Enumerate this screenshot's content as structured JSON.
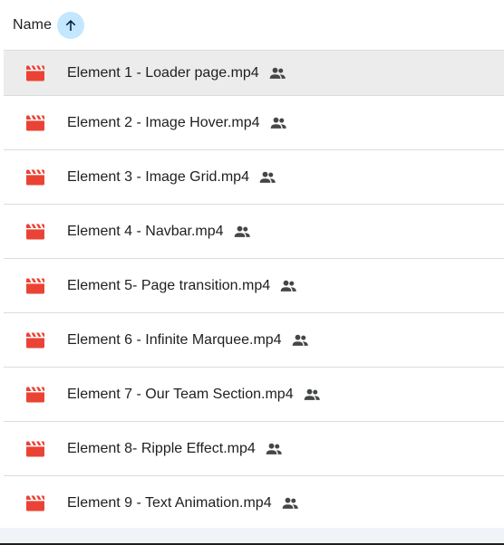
{
  "header": {
    "column_label": "Name",
    "sort_icon": "arrow-up-icon",
    "sort_color": "#c2e7ff"
  },
  "files": [
    {
      "name": "Element 1 - Loader page.mp4",
      "icon": "video-file-icon",
      "shared": true,
      "selected": true
    },
    {
      "name": "Element 2 - Image Hover.mp4",
      "icon": "video-file-icon",
      "shared": true
    },
    {
      "name": "Element 3 - Image Grid.mp4",
      "icon": "video-file-icon",
      "shared": true
    },
    {
      "name": "Element 4 - Navbar.mp4",
      "icon": "video-file-icon",
      "shared": true
    },
    {
      "name": "Element 5- Page transition.mp4",
      "icon": "video-file-icon",
      "shared": true
    },
    {
      "name": "Element 6 - Infinite Marquee.mp4",
      "icon": "video-file-icon",
      "shared": true
    },
    {
      "name": "Element 7 - Our Team Section.mp4",
      "icon": "video-file-icon",
      "shared": true
    },
    {
      "name": "Element 8- Ripple Effect.mp4",
      "icon": "video-file-icon",
      "shared": true
    },
    {
      "name": "Element 9 - Text Animation.mp4",
      "icon": "video-file-icon",
      "shared": true
    }
  ],
  "colors": {
    "video_icon": "#ea4335",
    "selected_row": "#ececec",
    "divider": "#dadce0"
  }
}
